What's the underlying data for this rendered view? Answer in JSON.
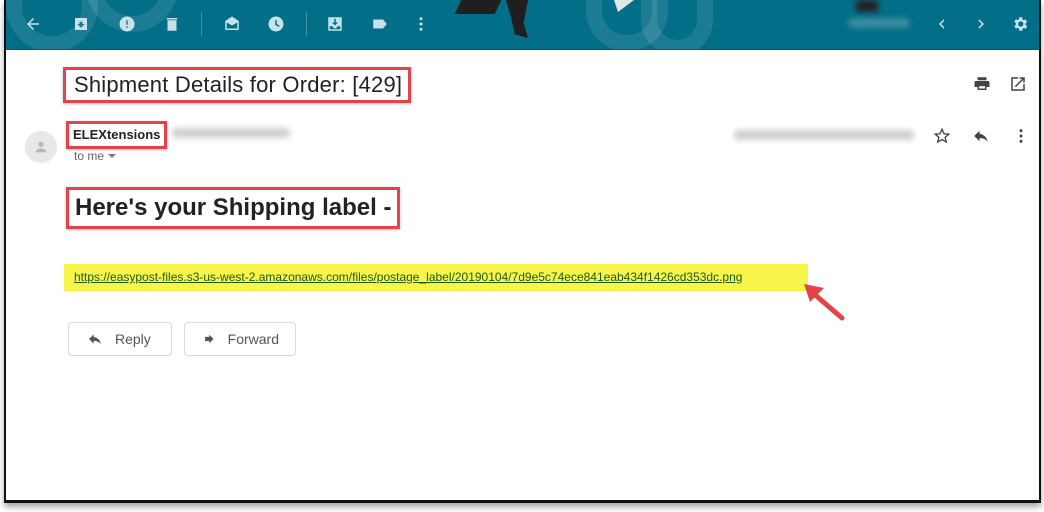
{
  "toolbar": {
    "icons": [
      "back-arrow-icon",
      "archive-icon",
      "report-spam-icon",
      "delete-icon",
      "mark-unread-icon",
      "snooze-icon",
      "move-to-icon",
      "label-icon",
      "more-vert-icon",
      "older-icon",
      "newer-icon",
      "settings-icon"
    ],
    "colors": {
      "background": "#036e87",
      "icon": "#c6e3ea"
    }
  },
  "email": {
    "subject": "Shipment Details for Order: [429]",
    "sender_name": "ELEXtensions",
    "recipient_label": "to me",
    "heading": "Here's your Shipping label -",
    "link_url": "https://easypost-files.s3-us-west-2.amazonaws.com/files/postage_label/20190104/7d9e5c74ece841eab434f1426cd353dc.png"
  },
  "actions": {
    "reply_label": "Reply",
    "forward_label": "Forward"
  },
  "annotations": {
    "highlight_color": "#f7f44a",
    "box_color": "#e5434a"
  }
}
